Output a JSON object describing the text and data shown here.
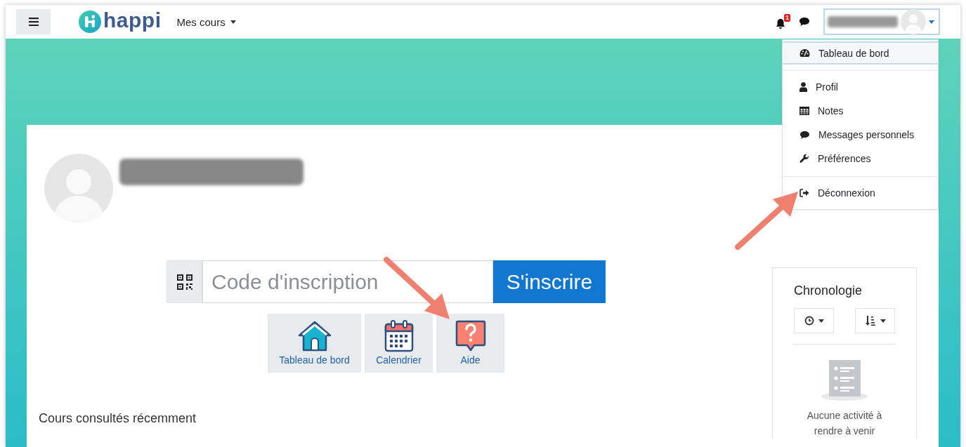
{
  "navbar": {
    "logo": "happi",
    "menu": "Mes cours",
    "notification_count": "1",
    "user_menu_expanded": true
  },
  "user_menu": {
    "groups": [
      [
        {
          "label": "Tableau de bord",
          "selected": true
        }
      ],
      [
        {
          "label": "Profil",
          "selected": false
        },
        {
          "label": "Notes",
          "selected": false
        },
        {
          "label": "Messages personnels",
          "selected": false
        },
        {
          "label": "Préférences",
          "selected": false
        }
      ],
      [
        {
          "label": "Déconnexion",
          "selected": false
        }
      ]
    ]
  },
  "enrol": {
    "placeholder": "Code d'inscription",
    "button": "S'inscrire"
  },
  "shortcuts": [
    {
      "label": "Tableau de bord"
    },
    {
      "label": "Calendrier"
    },
    {
      "label": "Aide"
    }
  ],
  "recent_courses": {
    "title": "Cours consultés récemment"
  },
  "timeline": {
    "title": "Chronologie",
    "empty_text": "Aucune activité à rendre à venir"
  }
}
